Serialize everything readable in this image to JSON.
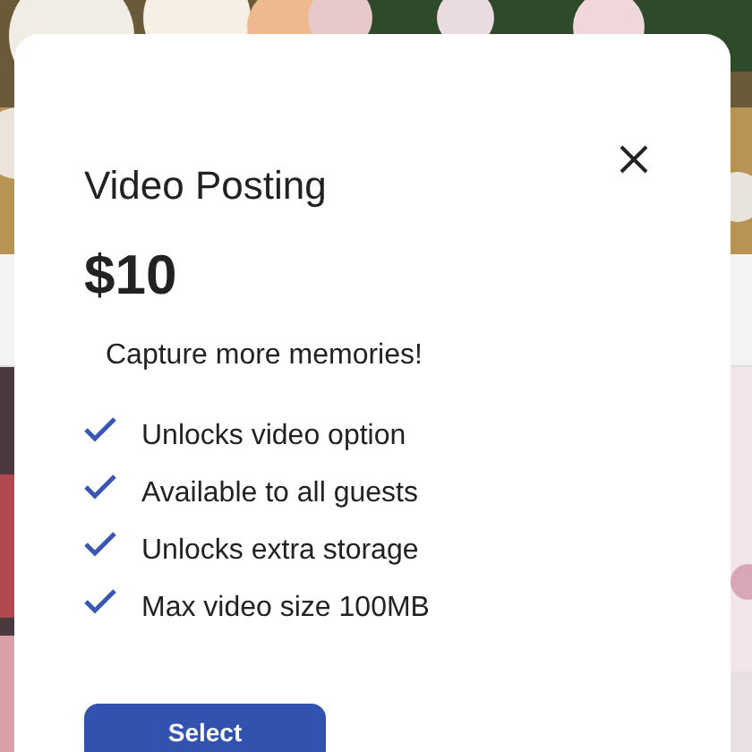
{
  "dialog": {
    "title": "Video Posting",
    "price": "$10",
    "subtitle": "Capture more memories!",
    "features": [
      {
        "text": "Unlocks video option",
        "checked": true
      },
      {
        "text": "Available to all guests",
        "checked": true
      },
      {
        "text": "Unlocks extra storage",
        "checked": true
      },
      {
        "text": "Max video size 100MB",
        "checked": true
      }
    ],
    "button": "Select"
  }
}
